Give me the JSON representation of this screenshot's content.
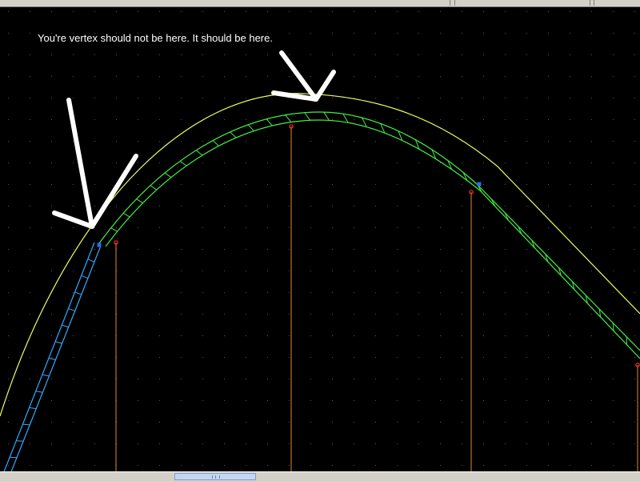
{
  "annotation": {
    "text": "You're vertex should not be here.  It should be here."
  },
  "canvas": {
    "background": "#000000",
    "grid_color": "#5a5a5a",
    "colors": {
      "outer_curve": "#e8ff60",
      "selected_track": "#33aaff",
      "track": "#44ee44",
      "guide_line": "#e08a2a",
      "guide_marker": "#ff2a2a",
      "vertex": "#2a6aff",
      "arrow": "#ffffff"
    }
  },
  "icons": {
    "vertex": "vertex-handle-icon",
    "marker": "guide-marker-icon",
    "arrow": "pointer-arrow-icon"
  }
}
